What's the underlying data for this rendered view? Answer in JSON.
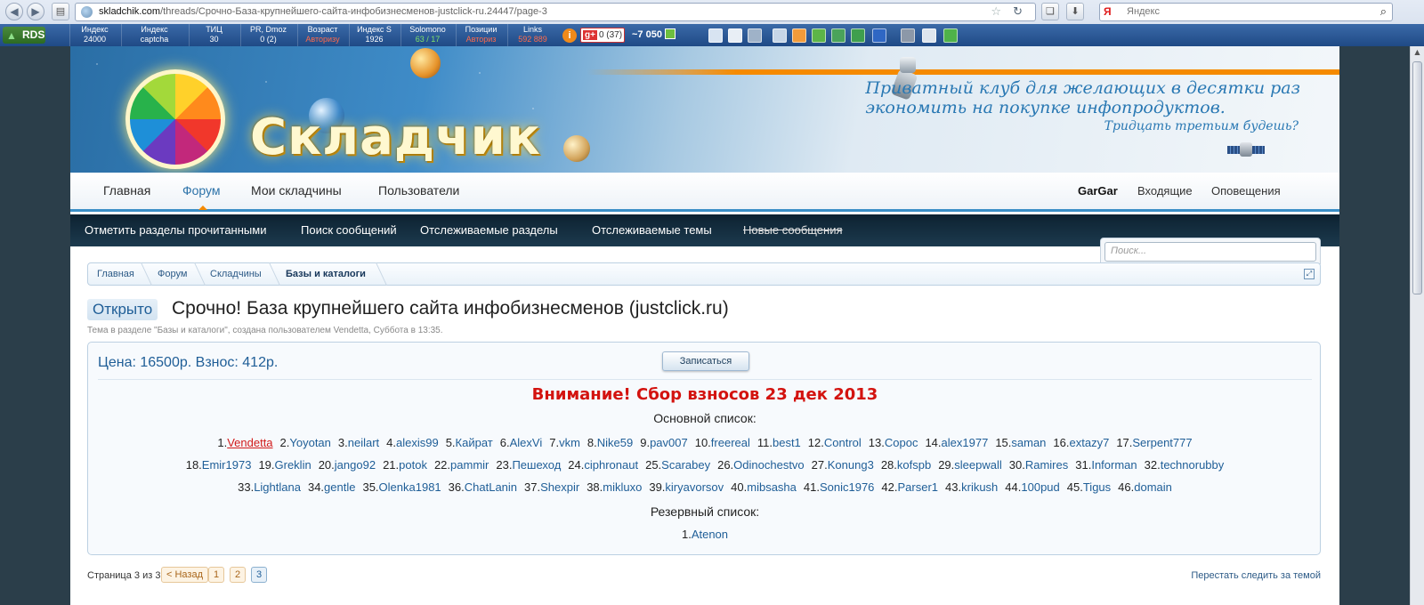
{
  "browser": {
    "url_host": "skladchik.com",
    "url_path": "/threads/Срочно-База-крупнейшего-сайта-инфобизнесменов-justclick-ru.24447/page-3",
    "search_engine_logo": "Я",
    "search_placeholder": "Яндекс"
  },
  "rds_bar": {
    "logo": "RDS",
    "metrics": [
      {
        "label": "Индекс",
        "value": "24000"
      },
      {
        "label": "Индекс",
        "value": "captcha"
      },
      {
        "label": "ТИЦ",
        "value": "30"
      },
      {
        "label": "PR, Dmoz",
        "value": "0 (2)"
      },
      {
        "label": "Возраст",
        "value": "Авторизу",
        "warn": true
      },
      {
        "label": "Индекс S",
        "value": "1926"
      },
      {
        "label": "Solomono",
        "value": "63 / 17"
      },
      {
        "label": "Позиции",
        "value": "Авториз",
        "warn": true
      },
      {
        "label": "Links",
        "value": "592 889",
        "warn": true
      }
    ],
    "gplus_count": "0 (37)",
    "rank_value": "~7 050"
  },
  "site": {
    "logo_text": "Складчик",
    "slogan_line1": "Приватный клуб для желающих в десятки раз",
    "slogan_line2": "экономить на покупке инфопродуктов.",
    "slogan_line3": "Тридцать третьим будешь?"
  },
  "nav": {
    "tabs": [
      "Главная",
      "Форум",
      "Мои складчины",
      "Пользователи"
    ],
    "active_tab": "Форум",
    "user": "GarGar",
    "inbox": "Входящие",
    "alerts": "Оповещения"
  },
  "subnav": {
    "links": [
      "Отметить разделы прочитанными",
      "Поиск сообщений",
      "Отслеживаемые разделы",
      "Отслеживаемые темы",
      "Новые сообщения"
    ]
  },
  "search": {
    "placeholder": "Поиск..."
  },
  "breadcrumb": [
    "Главная",
    "Форум",
    "Складчины",
    "Базы и каталоги"
  ],
  "thread": {
    "status": "Открыто",
    "title": "Срочно! База крупнейшего сайта инфобизнесменов (justclick.ru)",
    "meta": "Тема в разделе \"Базы и каталоги\", создана пользователем Vendetta, Суббота в 13:35."
  },
  "price_box": {
    "price_text": "Цена: 16500р.  Взнос: 412р.",
    "join_label": "Записаться",
    "alert": "Внимание! Сбор взносов 23 дек 2013",
    "main_list_label": "Основной список:",
    "main_list": [
      [
        "Vendetta",
        "Yoyotan",
        "neilart",
        "alexis99",
        "Кайрат",
        "AlexVi",
        "vkm",
        "Nike59",
        "pav007",
        "freereal",
        "best1",
        "Control",
        "Copoc",
        "alex1977",
        "saman",
        "extazy7",
        "Serpent777"
      ],
      [
        "Emir1973",
        "Greklin",
        "jango92",
        "potok",
        "pammir",
        "Пешеход",
        "ciphronaut",
        "Scarabey",
        "Odinochestvo",
        "Konung3",
        "kofspb",
        "sleepwall",
        "Ramires",
        "Informan",
        "technorubby"
      ],
      [
        "Lightlana",
        "gentle",
        "Olenka1981",
        "ChatLanin",
        "Shexpir",
        "mikluxo",
        "kiryavorsov",
        "mibsasha",
        "Sonic1976",
        "Parser1",
        "krikush",
        "100pud",
        "Tigus",
        "domain"
      ]
    ],
    "highlight_member": "Vendetta",
    "reserve_list_label": "Резервный список:",
    "reserve_list": [
      "Atenon"
    ]
  },
  "pagination": {
    "info": "Страница 3 из 3",
    "prev_label": "< Назад",
    "pages": [
      "1",
      "2",
      "3"
    ],
    "current_page": "3"
  },
  "unwatch_label": "Перестать следить за темой",
  "colors": {
    "link": "#1f5e97",
    "alert": "#d3130f",
    "accent_orange": "#f58a00",
    "subnav_bg": "#0d2231"
  }
}
